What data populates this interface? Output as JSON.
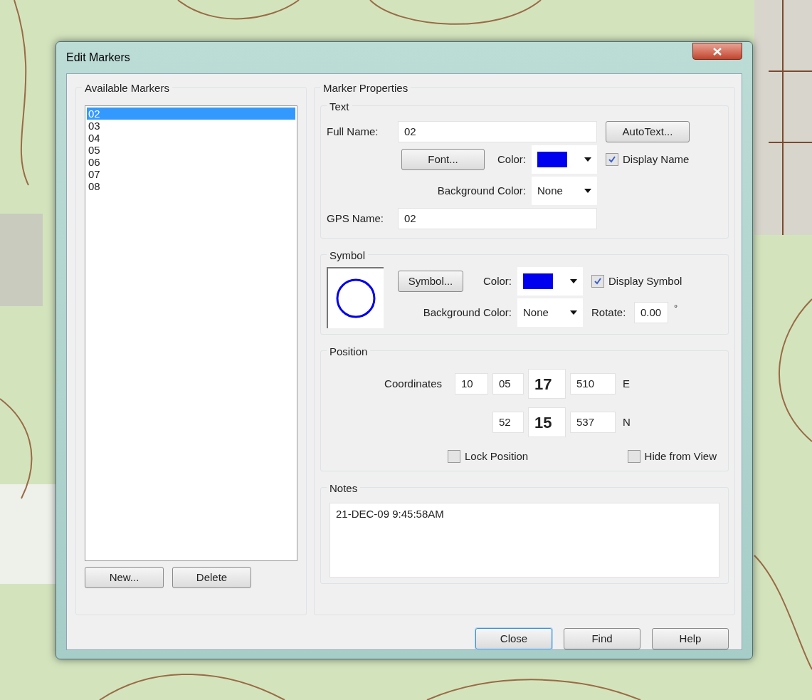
{
  "window": {
    "title": "Edit Markers"
  },
  "markers": {
    "label": "Available Markers",
    "items": [
      {
        "label": "02",
        "selected": true
      },
      {
        "label": "03",
        "selected": false
      },
      {
        "label": "04",
        "selected": false
      },
      {
        "label": "05",
        "selected": false
      },
      {
        "label": "06",
        "selected": false
      },
      {
        "label": "07",
        "selected": false
      },
      {
        "label": "08",
        "selected": false
      }
    ],
    "buttons": [
      "New...",
      "Delete"
    ]
  },
  "properties": {
    "label": "Marker Properties",
    "text": {
      "label": "Text",
      "full_name_label": "Full Name:",
      "full_name": "02",
      "autotext_button": "AutoText...",
      "font_button": "Font...",
      "color_label": "Color:",
      "color": "#0000ee",
      "display_name": {
        "label": "Display Name",
        "checked": true
      },
      "background_label": "Background Color:",
      "background": "None",
      "gps_name_label": "GPS Name:",
      "gps_name": "02"
    },
    "symbol": {
      "label": "Symbol",
      "symbol_button": "Symbol...",
      "color_label": "Color:",
      "color": "#0000ee",
      "display_symbol": {
        "label": "Display Symbol",
        "checked": true
      },
      "background_label": "Background Color:",
      "background": "None",
      "rotate_label": "Rotate:",
      "rotate": "0.00",
      "degree_mark": "°"
    },
    "position": {
      "label": "Position",
      "coordinates_label": "Coordinates",
      "rows": [
        {
          "fields": [
            {
              "value": "10",
              "kind": "plain"
            },
            {
              "value": "05",
              "kind": "plain"
            },
            {
              "value": "17",
              "kind": "large"
            },
            {
              "value": "510",
              "kind": "plain"
            }
          ],
          "hemisphere": "E"
        },
        {
          "fields": [
            {
              "value": "52",
              "kind": "plain"
            },
            {
              "value": "15",
              "kind": "large"
            },
            {
              "value": "537",
              "kind": "plain"
            }
          ],
          "hemisphere": "N"
        }
      ],
      "lock_position": {
        "label": "Lock Position",
        "checked": false
      },
      "hide_from_view": {
        "label": "Hide from View",
        "checked": false
      }
    },
    "notes": {
      "label": "Notes",
      "value": "21-DEC-09 9:45:58AM"
    }
  },
  "footer": [
    {
      "label": "Close",
      "default": true
    },
    {
      "label": "Find",
      "default": false
    },
    {
      "label": "Help",
      "default": false
    }
  ]
}
